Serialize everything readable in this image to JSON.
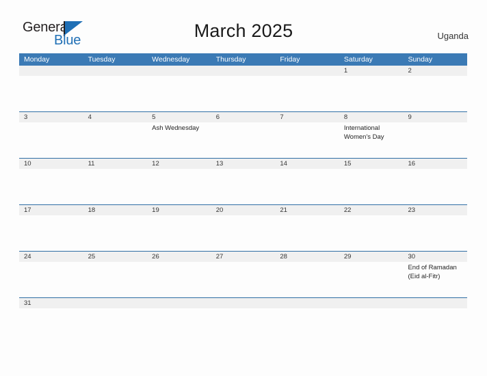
{
  "brand": {
    "name_part1": "General",
    "name_part2": "Blue"
  },
  "header": {
    "title": "March 2025",
    "country": "Uganda"
  },
  "colors": {
    "header_blue": "#3b7ab5",
    "rule_blue": "#2e6da4",
    "strip_gray": "#f0f0f0",
    "brand_blue": "#1f6fb5"
  },
  "calendar": {
    "weekdays": [
      "Monday",
      "Tuesday",
      "Wednesday",
      "Thursday",
      "Friday",
      "Saturday",
      "Sunday"
    ],
    "weeks": [
      {
        "days": [
          {
            "num": "",
            "event": ""
          },
          {
            "num": "",
            "event": ""
          },
          {
            "num": "",
            "event": ""
          },
          {
            "num": "",
            "event": ""
          },
          {
            "num": "",
            "event": ""
          },
          {
            "num": "1",
            "event": ""
          },
          {
            "num": "2",
            "event": ""
          }
        ]
      },
      {
        "days": [
          {
            "num": "3",
            "event": ""
          },
          {
            "num": "4",
            "event": ""
          },
          {
            "num": "5",
            "event": "Ash Wednesday"
          },
          {
            "num": "6",
            "event": ""
          },
          {
            "num": "7",
            "event": ""
          },
          {
            "num": "8",
            "event": "International\nWomen's Day"
          },
          {
            "num": "9",
            "event": ""
          }
        ]
      },
      {
        "days": [
          {
            "num": "10",
            "event": ""
          },
          {
            "num": "11",
            "event": ""
          },
          {
            "num": "12",
            "event": ""
          },
          {
            "num": "13",
            "event": ""
          },
          {
            "num": "14",
            "event": ""
          },
          {
            "num": "15",
            "event": ""
          },
          {
            "num": "16",
            "event": ""
          }
        ]
      },
      {
        "days": [
          {
            "num": "17",
            "event": ""
          },
          {
            "num": "18",
            "event": ""
          },
          {
            "num": "19",
            "event": ""
          },
          {
            "num": "20",
            "event": ""
          },
          {
            "num": "21",
            "event": ""
          },
          {
            "num": "22",
            "event": ""
          },
          {
            "num": "23",
            "event": ""
          }
        ]
      },
      {
        "days": [
          {
            "num": "24",
            "event": ""
          },
          {
            "num": "25",
            "event": ""
          },
          {
            "num": "26",
            "event": ""
          },
          {
            "num": "27",
            "event": ""
          },
          {
            "num": "28",
            "event": ""
          },
          {
            "num": "29",
            "event": ""
          },
          {
            "num": "30",
            "event": "End of Ramadan\n(Eid al-Fitr)"
          }
        ]
      },
      {
        "days": [
          {
            "num": "31",
            "event": ""
          },
          {
            "num": "",
            "event": ""
          },
          {
            "num": "",
            "event": ""
          },
          {
            "num": "",
            "event": ""
          },
          {
            "num": "",
            "event": ""
          },
          {
            "num": "",
            "event": ""
          },
          {
            "num": "",
            "event": ""
          }
        ]
      }
    ]
  }
}
